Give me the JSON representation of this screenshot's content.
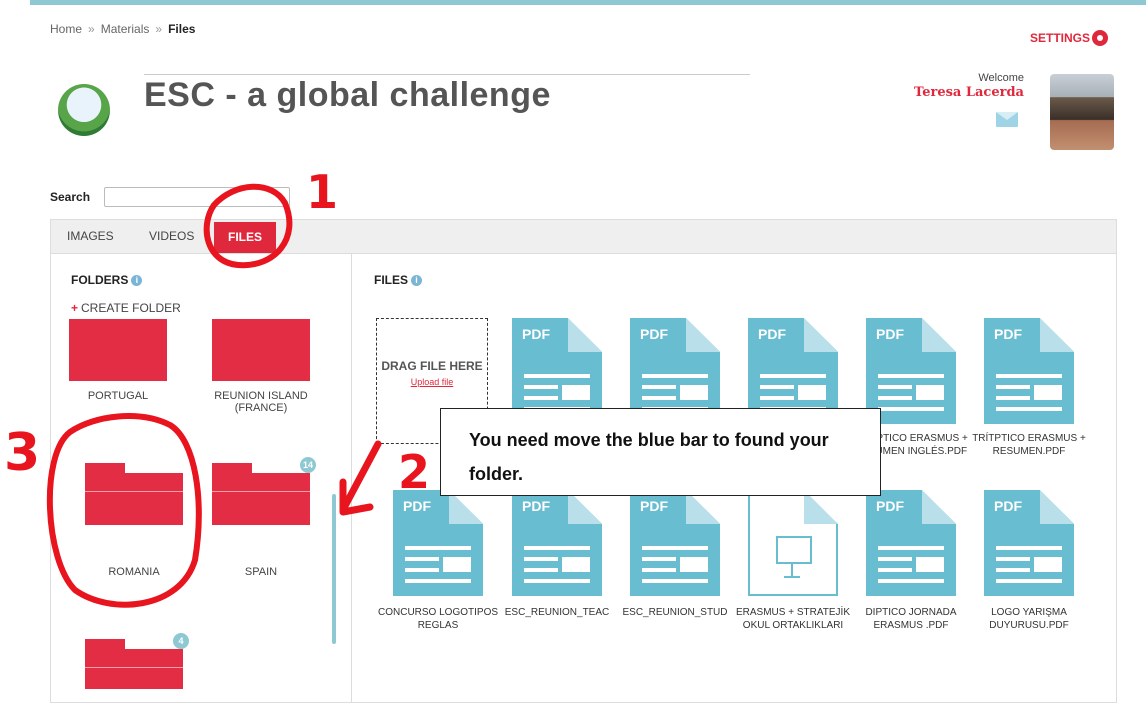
{
  "breadcrumb": [
    "Home",
    "Materials",
    "Files"
  ],
  "breadcrumb_sep": "»",
  "settings_label": "SETTINGS",
  "site_title": "ESC - a global challenge",
  "welcome": {
    "label": "Welcome",
    "name": "Teresa Lacerda"
  },
  "search": {
    "label": "Search",
    "value": ""
  },
  "tabs": [
    {
      "label": "IMAGES",
      "active": false
    },
    {
      "label": "VIDEOS",
      "active": false
    },
    {
      "label": "FILES",
      "active": true
    }
  ],
  "folders_panel": {
    "heading": "FOLDERS",
    "create_label": "CREATE FOLDER",
    "items": [
      {
        "name": "PORTUGAL",
        "badge": ""
      },
      {
        "name": "REUNION ISLAND (FRANCE)",
        "badge": ""
      },
      {
        "name": "ROMANIA",
        "badge": ""
      },
      {
        "name": "SPAIN",
        "badge": "14"
      },
      {
        "name": "",
        "badge": "4"
      }
    ]
  },
  "files_panel": {
    "heading": "FILES",
    "dropzone": {
      "title": "DRAG FILE HERE",
      "link": "Upload file"
    },
    "files": [
      {
        "name": "TRÍTPTICO ERASMUS + RESUMEN INGLÉS.PDF",
        "type": "pdf",
        "icon_label": "PDF"
      },
      {
        "name": "TRÍTPTICO ERASMUS + RESUMEN.PDF",
        "type": "pdf",
        "icon_label": "PDF"
      },
      {
        "name": "CONCURSO LOGOTIPOS REGLAS",
        "type": "pdf",
        "icon_label": "PDF"
      },
      {
        "name": "ESC_REUNION_TEAC",
        "type": "pdf",
        "icon_label": "PDF"
      },
      {
        "name": "ESC_REUNION_STUD",
        "type": "pdf",
        "icon_label": "PDF"
      },
      {
        "name": "ERASMUS + STRATEJİK OKUL ORTAKLIKLARI",
        "type": "ppt",
        "icon_label": ""
      },
      {
        "name": "DIPTICO JORNADA ERASMUS .PDF",
        "type": "pdf",
        "icon_label": "PDF"
      },
      {
        "name": "LOGO YARIŞMA DUYURUSU.PDF",
        "type": "pdf",
        "icon_label": "PDF"
      }
    ]
  },
  "callout_text": "You need move the blue bar to found your folder.",
  "annotations": {
    "n1": "1",
    "n2": "2",
    "n3": "3",
    "color": "#e8141e"
  },
  "colors": {
    "accent": "#e0283c",
    "folder": "#e32d45",
    "pdf": "#69bdd1",
    "bar": "#8ec9d3"
  }
}
